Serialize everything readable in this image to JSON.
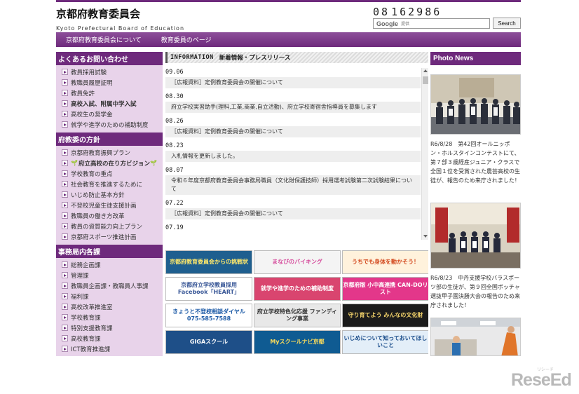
{
  "header": {
    "title": "京都府教育委員会",
    "subtitle": "Kyoto Prefectural Board of Education",
    "counter_digits": [
      "0",
      "8",
      " ",
      "1",
      "6",
      "2",
      "9",
      "8",
      "6"
    ],
    "search": {
      "logo": "Google",
      "provided": "提供",
      "button": "Search"
    }
  },
  "topnav": [
    "京都府教育委員会について",
    "教育委員のページ"
  ],
  "sidebar": {
    "sections": [
      {
        "title": "よくあるお問い合わせ",
        "items": [
          {
            "label": "教員採用試験"
          },
          {
            "label": "教職員履歴証明"
          },
          {
            "label": "教員免許"
          },
          {
            "label": "高校入試、附属中学入試",
            "bold": true
          },
          {
            "label": "高校生の奨学金"
          },
          {
            "label": "就学や進学のための補助制度"
          }
        ]
      },
      {
        "title": "府教委の方針",
        "items": [
          {
            "label": "京都府教育振興プラン"
          },
          {
            "label": "府立高校の在り方ビジョン",
            "bold": true,
            "sprout": "🌱"
          },
          {
            "label": "学校教育の重点"
          },
          {
            "label": "社会教育を推進するために"
          },
          {
            "label": "いじめ防止基本方針"
          },
          {
            "label": "不登校児童生徒支援計画"
          },
          {
            "label": "教職員の働き方改革"
          },
          {
            "label": "教員の資質能力向上プラン"
          },
          {
            "label": "京都府スポーツ推進計画"
          }
        ]
      },
      {
        "title": "事務局内各課",
        "items": [
          {
            "label": "総務企画課"
          },
          {
            "label": "管理課"
          },
          {
            "label": "教職員企画課・教職員人事課"
          },
          {
            "label": "福利課"
          },
          {
            "label": "高校改革推進室"
          },
          {
            "label": "学校教育課"
          },
          {
            "label": "特別支援教育課"
          },
          {
            "label": "高校教育課"
          },
          {
            "label": "ICT教育推進課"
          }
        ]
      }
    ]
  },
  "info": {
    "head_en": "INFORMATION",
    "head_jp": "新着情報・プレスリリース",
    "entries": [
      {
        "date": "09.06",
        "text": "［広報資料］定例教育委員会の開催について"
      },
      {
        "date": "08.30",
        "text": "府立学校実習助手(理科,工業,商業,自立活動)、府立学校寄宿舎指導員を募集します"
      },
      {
        "date": "08.26",
        "text": "［広報資料］定例教育委員会の開催について"
      },
      {
        "date": "08.23",
        "text": "入札情報を更新しました。"
      },
      {
        "date": "08.07",
        "text": "令和６年度京都府教育委員会事務局職員（文化財保護技師）採用選考試験第二次試験結果について"
      },
      {
        "date": "07.22",
        "text": "［広報資料］定例教育委員会の開催について"
      },
      {
        "date": "07.19",
        "text": ""
      }
    ]
  },
  "banners": [
    {
      "text": "京都府教育委員会からの挑戦状",
      "bg": "#1f5f8f",
      "fg": "#ffe86a"
    },
    {
      "text": "まなびのバイキング",
      "bg": "#f4f4f4",
      "fg": "#d64f9e"
    },
    {
      "text": "うちでも身体を動かそう！",
      "bg": "#fff2dc",
      "fg": "#d34a1f"
    },
    {
      "text": "京都府立学校教員採用 Facebook「HEART」",
      "bg": "#ffffff",
      "fg": "#3b5998"
    },
    {
      "text": "就学や進学のための補助制度",
      "bg": "#d9456f",
      "fg": "#ffffff"
    },
    {
      "text": "京都府版 小中高連携 CAN-DOリスト",
      "bg": "#e3378a",
      "fg": "#ffffff"
    },
    {
      "text": "きょうと不登校相談ダイヤル 075-585-7588",
      "bg": "#ffffff",
      "fg": "#1c5aa6"
    },
    {
      "text": "府立学校特色化応援 ファンディング事業",
      "bg": "#e8e8e8",
      "fg": "#333333"
    },
    {
      "text": "守り育てよう みんなの文化財",
      "bg": "#1b1b1b",
      "fg": "#f3d36b"
    },
    {
      "text": "GIGAスクール",
      "bg": "#1e4f88",
      "fg": "#ffffff"
    },
    {
      "text": "Myスクールナビ京都",
      "bg": "#0f5b92",
      "fg": "#ffde5a"
    },
    {
      "text": "いじめについて知っておいてほしいこと",
      "bg": "#e3eef8",
      "fg": "#1d4f8c"
    }
  ],
  "photo_news": {
    "title": "Photo News",
    "items": [
      {
        "caption": "R6/8/28　第42回オールニッポン・ホルスタインコンテストにて、第７部３歳経産ジュニア・クラスで全国１位を受賞された農芸高校の生徒が、報告のため来庁されました！"
      },
      {
        "caption": "R6/8/23　中丹支援学校バラスポーツ部の生徒が、第９回全国ボッチャ選抜甲子園決勝大会の報告のため来庁されました！"
      }
    ]
  },
  "watermark": {
    "text": "ReseEd",
    "small": "リシード"
  }
}
